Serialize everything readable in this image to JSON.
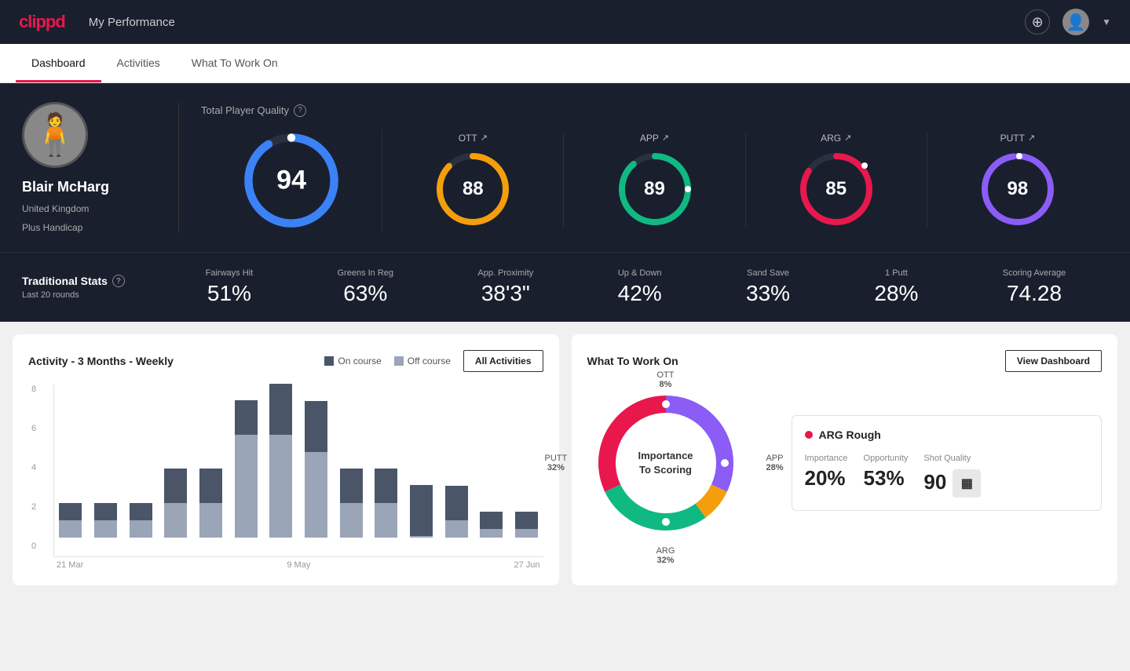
{
  "header": {
    "logo": "clippd",
    "title": "My Performance",
    "add_label": "+",
    "avatar_label": "User Avatar"
  },
  "tabs": [
    {
      "id": "dashboard",
      "label": "Dashboard",
      "active": true
    },
    {
      "id": "activities",
      "label": "Activities",
      "active": false
    },
    {
      "id": "what-to-work-on",
      "label": "What To Work On",
      "active": false
    }
  ],
  "player": {
    "name": "Blair McHarg",
    "country": "United Kingdom",
    "handicap": "Plus Handicap"
  },
  "total_quality": {
    "label": "Total Player Quality",
    "score": 94,
    "color": "#3b82f6"
  },
  "category_scores": [
    {
      "id": "ott",
      "label": "OTT",
      "score": 88,
      "color": "#f59e0b",
      "track": "#2a2a3a"
    },
    {
      "id": "app",
      "label": "APP",
      "score": 89,
      "color": "#10b981",
      "track": "#2a2a3a"
    },
    {
      "id": "arg",
      "label": "ARG",
      "score": 85,
      "color": "#e8184c",
      "track": "#2a2a3a"
    },
    {
      "id": "putt",
      "label": "PUTT",
      "score": 98,
      "color": "#8b5cf6",
      "track": "#2a2a3a"
    }
  ],
  "traditional_stats": {
    "label": "Traditional Stats",
    "subtitle": "Last 20 rounds",
    "items": [
      {
        "name": "Fairways Hit",
        "value": "51%"
      },
      {
        "name": "Greens In Reg",
        "value": "63%"
      },
      {
        "name": "App. Proximity",
        "value": "38'3\""
      },
      {
        "name": "Up & Down",
        "value": "42%"
      },
      {
        "name": "Sand Save",
        "value": "33%"
      },
      {
        "name": "1 Putt",
        "value": "28%"
      },
      {
        "name": "Scoring Average",
        "value": "74.28"
      }
    ]
  },
  "activity_chart": {
    "title": "Activity - 3 Months - Weekly",
    "legend_on": "On course",
    "legend_off": "Off course",
    "all_activities_btn": "All Activities",
    "y_labels": [
      "8",
      "6",
      "4",
      "2",
      "0"
    ],
    "x_labels": [
      "21 Mar",
      "9 May",
      "27 Jun"
    ],
    "bars": [
      {
        "on": 1,
        "off": 1
      },
      {
        "on": 1,
        "off": 1
      },
      {
        "on": 1,
        "off": 1
      },
      {
        "on": 2,
        "off": 2
      },
      {
        "on": 2,
        "off": 2
      },
      {
        "on": 2,
        "off": 6
      },
      {
        "on": 3,
        "off": 6
      },
      {
        "on": 3,
        "off": 5
      },
      {
        "on": 2,
        "off": 2
      },
      {
        "on": 2,
        "off": 2
      },
      {
        "on": 3,
        "off": 0
      },
      {
        "on": 2,
        "off": 1
      },
      {
        "on": 1,
        "off": 0.5
      },
      {
        "on": 1,
        "off": 0.5
      }
    ]
  },
  "what_to_work_on": {
    "title": "What To Work On",
    "view_dashboard_btn": "View Dashboard",
    "donut_center": "Importance\nTo Scoring",
    "segments": [
      {
        "id": "ott",
        "label": "OTT",
        "pct": "8%",
        "color": "#f59e0b"
      },
      {
        "id": "app",
        "label": "APP",
        "pct": "28%",
        "color": "#10b981"
      },
      {
        "id": "arg",
        "label": "ARG",
        "pct": "32%",
        "color": "#e8184c"
      },
      {
        "id": "putt",
        "label": "PUTT",
        "pct": "32%",
        "color": "#8b5cf6"
      }
    ],
    "detail": {
      "title": "ARG Rough",
      "importance": "20%",
      "opportunity": "53%",
      "shot_quality": "90",
      "importance_label": "Importance",
      "opportunity_label": "Opportunity",
      "shot_quality_label": "Shot Quality"
    }
  }
}
